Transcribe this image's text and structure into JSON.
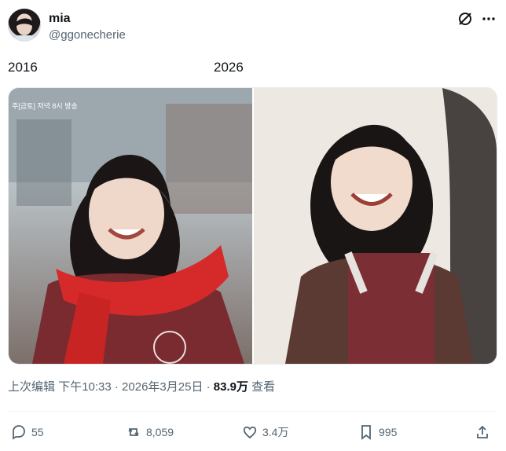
{
  "tweet": {
    "author_name": "mia",
    "author_handle": "@ggonecherie",
    "label_left": "2016",
    "label_right": "2026",
    "images": [
      {
        "caption": "주[금토] 저녁 8시 방송"
      },
      {
        "caption": ""
      }
    ],
    "meta": {
      "edited": "上次编辑",
      "time_date": "下午10:33 · 2026年3月25日 ·",
      "views": "83.9万",
      "views_label": "查看"
    },
    "actions": {
      "replies": "55",
      "retweets": "8,059",
      "likes": "3.4万",
      "bookmarks": "995"
    }
  },
  "icons": {
    "avatar": "profile-photo",
    "grok": "grok-icon",
    "more": "more-icon",
    "reply": "reply-icon",
    "retweet": "retweet-icon",
    "like": "heart-icon",
    "bookmark": "bookmark-icon",
    "share": "share-icon"
  },
  "colors": {
    "text_primary": "#0f1419",
    "text_secondary": "#536471",
    "divider": "#eff3f4",
    "scarf_red": "#d62a2a"
  }
}
